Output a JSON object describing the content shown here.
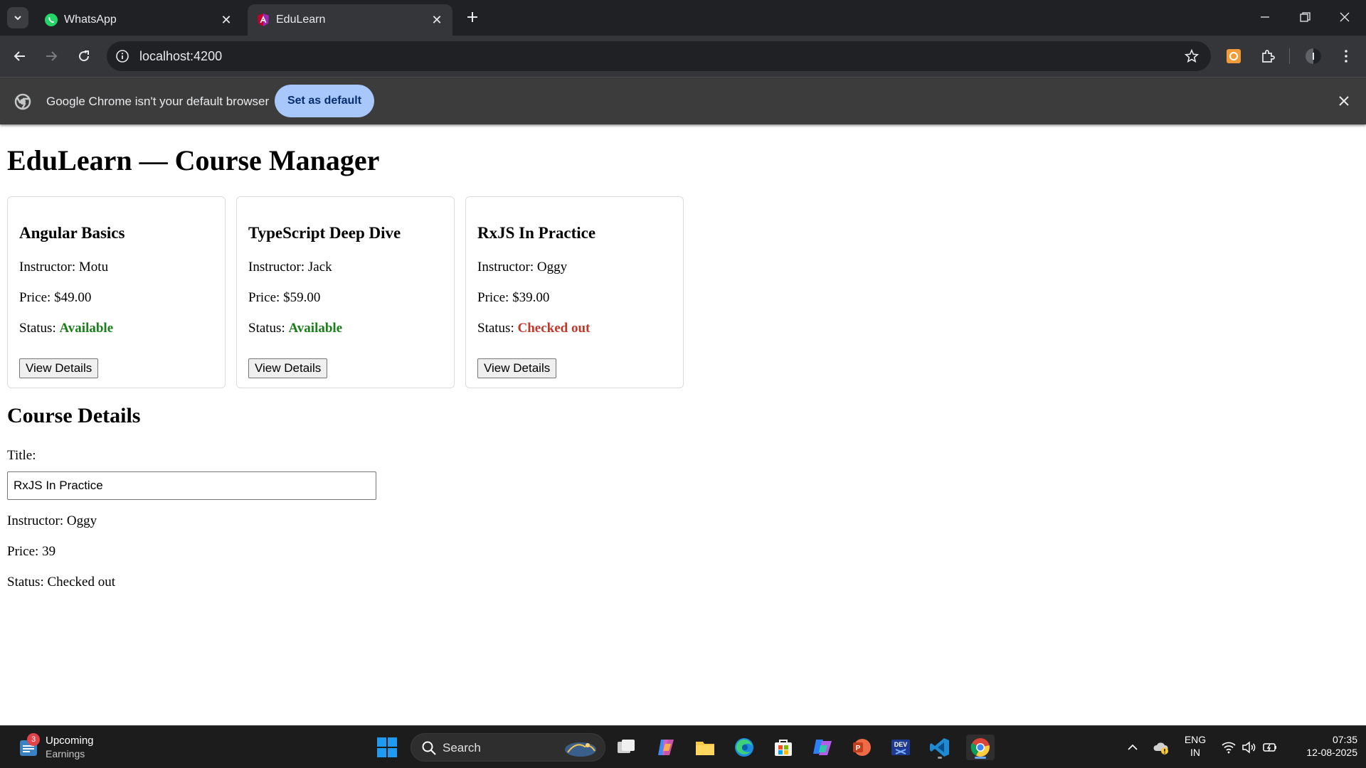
{
  "browser": {
    "tabs": [
      {
        "title": "WhatsApp",
        "active": false
      },
      {
        "title": "EduLearn",
        "active": true
      }
    ],
    "url": "localhost:4200",
    "infobar": {
      "message": "Google Chrome isn't your default browser",
      "button": "Set as default"
    }
  },
  "page": {
    "title": "EduLearn — Course Manager",
    "instructor_label": "Instructor:",
    "price_label": "Price:",
    "status_label": "Status:",
    "view_button": "View Details",
    "courses": [
      {
        "title": "Angular Basics",
        "instructor": "Motu",
        "price": "$49.00",
        "status": "Available"
      },
      {
        "title": "TypeScript Deep Dive",
        "instructor": "Jack",
        "price": "$59.00",
        "status": "Available"
      },
      {
        "title": "RxJS In Practice",
        "instructor": "Oggy",
        "price": "$39.00",
        "status": "Checked out"
      }
    ],
    "details": {
      "heading": "Course Details",
      "title_label": "Title:",
      "title_value": "RxJS In Practice",
      "instructor_line": "Instructor: Oggy",
      "price_line": "Price: 39",
      "status_line": "Status: Checked out"
    }
  },
  "colors": {
    "available": "#1a7f1a",
    "checked_out": "#c0392b",
    "infobar_button": "#a8c7fa"
  },
  "taskbar": {
    "widget": {
      "badge": "3",
      "title": "Upcoming",
      "subtitle": "Earnings"
    },
    "search_label": "Search",
    "apps": [
      "start-icon",
      "task-view-icon",
      "copilot-icon",
      "file-explorer-icon",
      "edge-icon",
      "store-icon",
      "m365-icon",
      "powerpoint-icon",
      "dev-home-icon",
      "vscode-icon",
      "chrome-icon"
    ],
    "tray": {
      "lang_top": "ENG",
      "lang_bottom": "IN",
      "time": "07:35",
      "date": "12-08-2025"
    }
  }
}
